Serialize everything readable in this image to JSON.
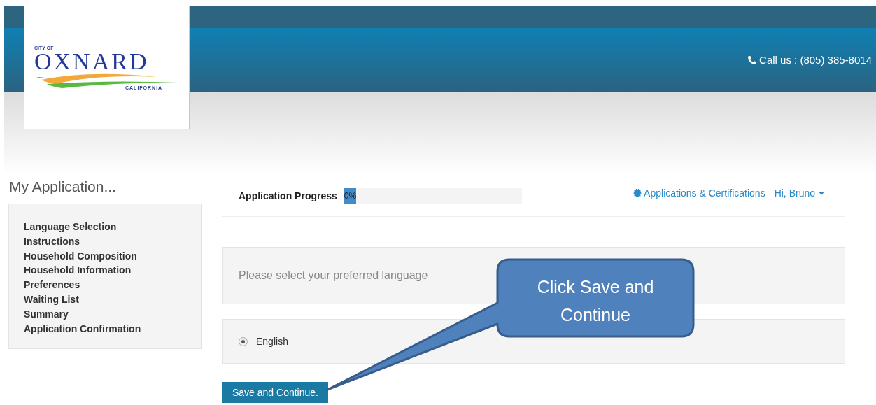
{
  "header": {
    "logo": {
      "top": "CITY OF",
      "name": "OXNARD",
      "bottom": "CALIFORNIA"
    },
    "phone": "Call us : (805) 385-8014"
  },
  "sidebar": {
    "title": "My Application...",
    "items": [
      "Language Selection",
      "Instructions",
      "Household Composition",
      "Household Information",
      "Preferences",
      "Waiting List",
      "Summary",
      "Application Confirmation"
    ]
  },
  "progress": {
    "label": "Application Progress",
    "reading": "0%",
    "level": 0
  },
  "nav": {
    "applications": "Applications & Certifications",
    "user": "Hi, Bruno"
  },
  "question": "Please select your preferred language",
  "options": [
    {
      "label": "English",
      "selected": true
    }
  ],
  "button": "Save and Continue.",
  "callout": "Click Save and Continue"
}
